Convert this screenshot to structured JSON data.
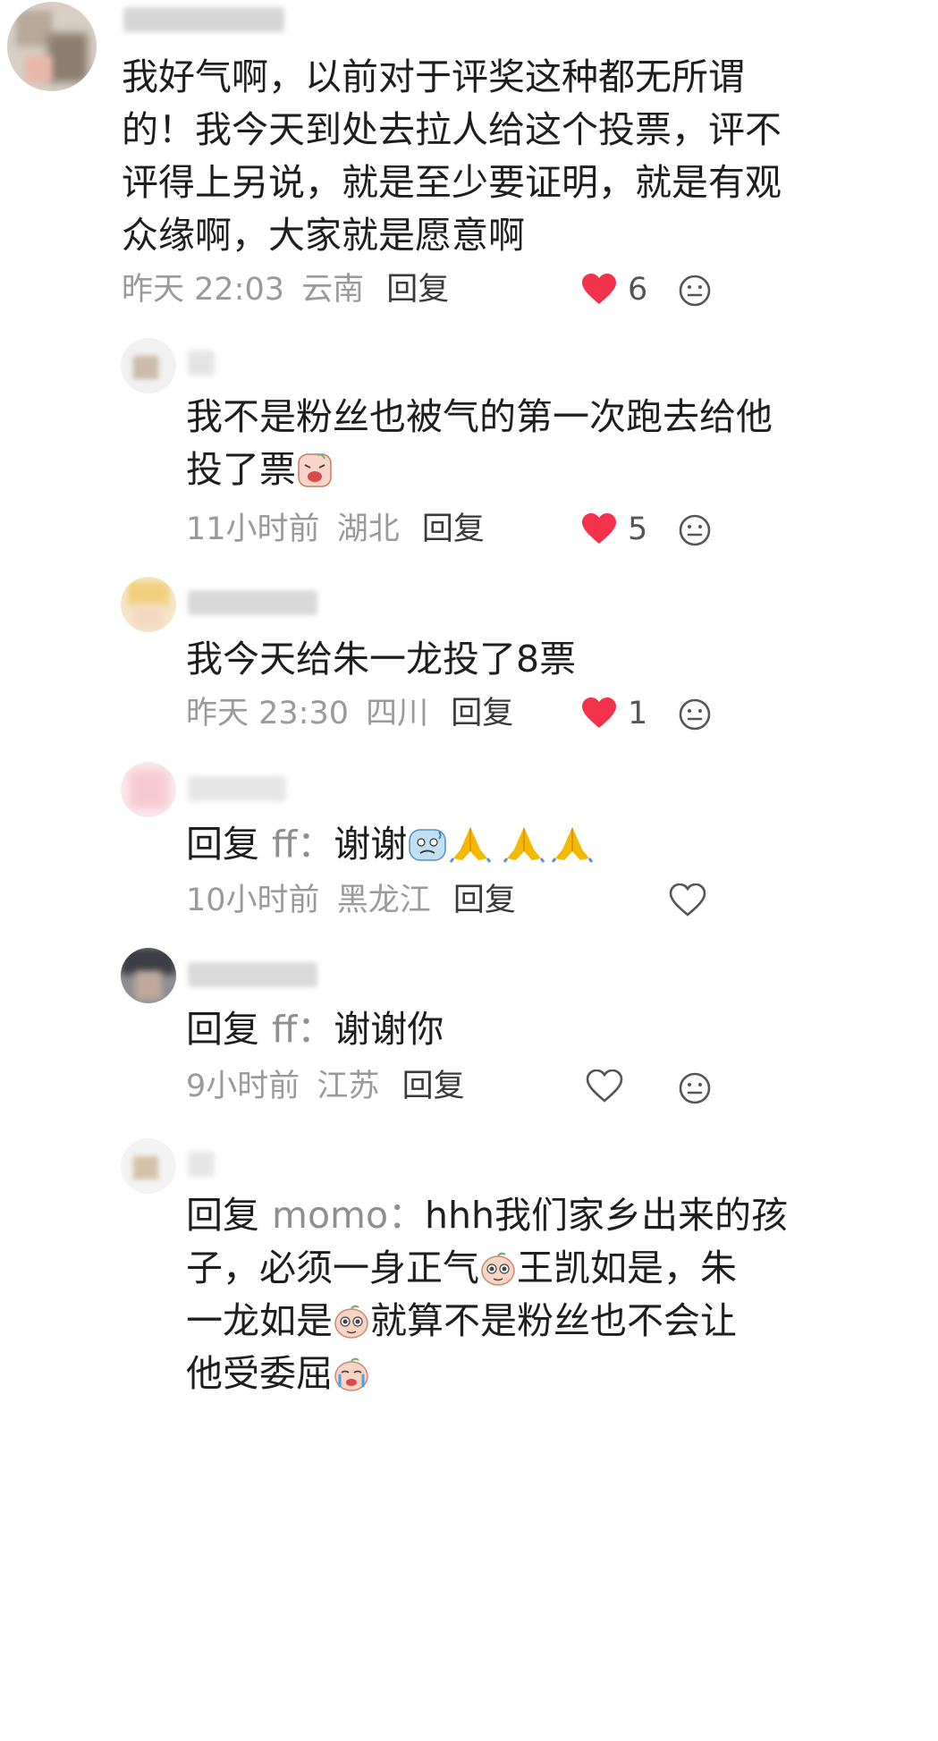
{
  "comments": [
    {
      "id": "c1",
      "text_lines": [
        "我好气啊，以前对于评奖这种都无所谓",
        "的！我今天到处去拉人给这个投票，评不",
        "评得上另说，就是至少要证明，就是有观",
        "众缘啊，大家就是愿意啊"
      ],
      "time": "昨天 22:03",
      "location": "云南",
      "reply_label": "回复",
      "likes": "6",
      "liked": true
    },
    {
      "id": "r1",
      "text_lines": [
        "我不是粉丝也被气的第一次跑去给他",
        "投了票"
      ],
      "time": "11小时前",
      "location": "湖北",
      "reply_label": "回复",
      "likes": "5",
      "liked": true
    },
    {
      "id": "r2",
      "text_lines": [
        "我今天给朱一龙投了8票"
      ],
      "time": "昨天 23:30",
      "location": "四川",
      "reply_label": "回复",
      "likes": "1",
      "liked": true
    },
    {
      "id": "r3",
      "reply_prefix": "回复",
      "reply_to": "ff：",
      "text": "谢谢",
      "time": "10小时前",
      "location": "黑龙江",
      "reply_label": "回复",
      "liked": false
    },
    {
      "id": "r4",
      "reply_prefix": "回复",
      "reply_to": "ff：",
      "text": "谢谢你",
      "time": "9小时前",
      "location": "江苏",
      "reply_label": "回复",
      "liked": false
    },
    {
      "id": "r5",
      "reply_prefix": "回复",
      "reply_to": "momo：",
      "line1_text": "hhh我们家乡出来的孩",
      "line2_a": "子，必须一身正气",
      "line2_b": "王凯如是，朱",
      "line3_a": "一龙如是",
      "line3_b": "就算不是粉丝也不会让",
      "line4_a": "他受委屈",
      "reply_label": "回复"
    }
  ],
  "colors": {
    "heart_red": "#f2334b",
    "meta_gray": "#9a9a9a",
    "emoji_folded_hands": "#f5b800"
  },
  "icons": {
    "like": "heart-icon",
    "dislike": "neutral-face-icon",
    "emojis": [
      "tired-face-emoji",
      "anxious-sweat-emoji",
      "folded-hands-emoji",
      "pleading-face-emoji",
      "crying-face-emoji"
    ]
  }
}
